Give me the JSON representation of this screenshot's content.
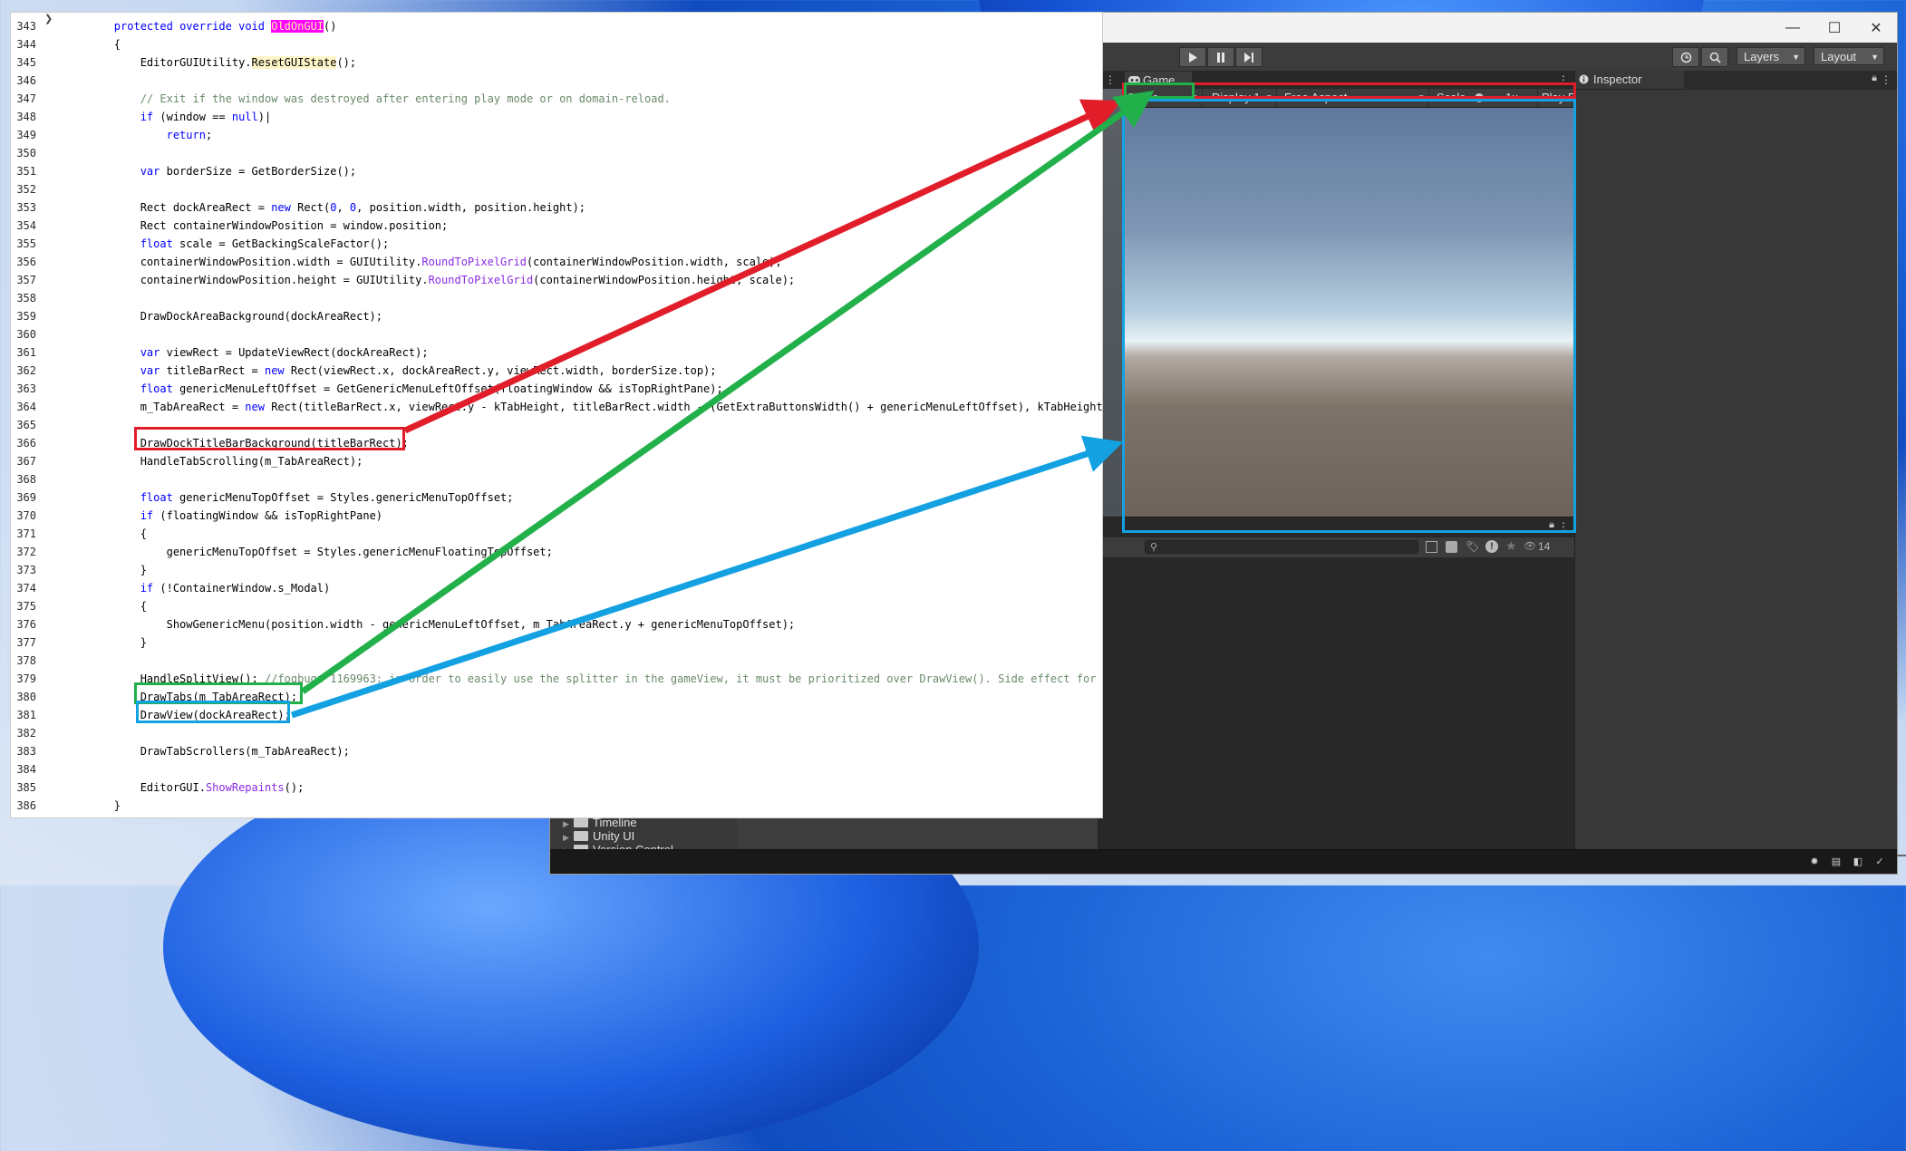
{
  "unity": {
    "window_controls": {
      "minimize": "—",
      "maximize": "☐",
      "close": "✕"
    },
    "toolbar": {
      "layers": "Layers",
      "layout": "Layout"
    },
    "game_tab": {
      "label": "Game"
    },
    "game_controls": {
      "mode": "Game",
      "display": "Display 1",
      "aspect": "Free Aspect",
      "scale_label": "Scale",
      "scale_value": "1x",
      "play_label": "Play F"
    },
    "inspector": {
      "label": "Inspector"
    },
    "bottom_panel": {
      "hidden_count": "14"
    },
    "project_tree": [
      "Timeline",
      "Unity UI",
      "Version Control"
    ]
  },
  "code": [
    {
      "n": "343",
      "html": "        <span class=\"kw\">protected</span> <span class=\"kw\">override</span> <span class=\"kw\">void</span> <span class=\"hl\">OldOnGUI</span>()"
    },
    {
      "n": "344",
      "html": "        {"
    },
    {
      "n": "345",
      "html": "            EditorGUIUtility.<span class=\"hlc\">ResetGUIState</span>();"
    },
    {
      "n": "346",
      "html": ""
    },
    {
      "n": "347",
      "html": "            <span class=\"cm\">// Exit if the window was destroyed after entering play mode or on domain-reload.</span>"
    },
    {
      "n": "348",
      "html": "            <span class=\"kw\">if</span> (window == <span class=\"kw\">null</span>)|"
    },
    {
      "n": "349",
      "html": "                <span class=\"kw\">return</span>;"
    },
    {
      "n": "350",
      "html": ""
    },
    {
      "n": "351",
      "html": "            <span class=\"kw\">var</span> borderSize = GetBorderSize();"
    },
    {
      "n": "352",
      "html": ""
    },
    {
      "n": "353",
      "html": "            Rect dockAreaRect = <span class=\"kw\">new</span> Rect(<span class=\"kw\">0</span>, <span class=\"kw\">0</span>, position.width, position.height);"
    },
    {
      "n": "354",
      "html": "            Rect containerWindowPosition = window.position;"
    },
    {
      "n": "355",
      "html": "            <span class=\"kw\">float</span> scale = GetBackingScaleFactor();"
    },
    {
      "n": "356",
      "html": "            containerWindowPosition.width = GUIUtility.<span class=\"md\">RoundToPixelGrid</span>(containerWindowPosition.width, scale);"
    },
    {
      "n": "357",
      "html": "            containerWindowPosition.height = GUIUtility.<span class=\"md\">RoundToPixelGrid</span>(containerWindowPosition.height, scale);"
    },
    {
      "n": "358",
      "html": ""
    },
    {
      "n": "359",
      "html": "            DrawDockAreaBackground(dockAreaRect);"
    },
    {
      "n": "360",
      "html": ""
    },
    {
      "n": "361",
      "html": "            <span class=\"kw\">var</span> viewRect = UpdateViewRect(dockAreaRect);"
    },
    {
      "n": "362",
      "html": "            <span class=\"kw\">var</span> titleBarRect = <span class=\"kw\">new</span> Rect(viewRect.x, dockAreaRect.y, viewRect.width, borderSize.top);"
    },
    {
      "n": "363",
      "html": "            <span class=\"kw\">float</span> genericMenuLeftOffset = GetGenericMenuLeftOffset(floatingWindow &amp;&amp; isTopRightPane);"
    },
    {
      "n": "364",
      "html": "            m_TabAreaRect = <span class=\"kw\">new</span> Rect(titleBarRect.x, viewRect.y - kTabHeight, titleBarRect.width - (GetExtraButtonsWidth() + genericMenuLeftOffset), kTabHeight);"
    },
    {
      "n": "365",
      "html": ""
    },
    {
      "n": "366",
      "html": "            DrawDockTitleBarBackground(titleBarRect);"
    },
    {
      "n": "367",
      "html": "            HandleTabScrolling(m_TabAreaRect);"
    },
    {
      "n": "368",
      "html": ""
    },
    {
      "n": "369",
      "html": "            <span class=\"kw\">float</span> genericMenuTopOffset = Styles.genericMenuTopOffset;"
    },
    {
      "n": "370",
      "html": "            <span class=\"kw\">if</span> (floatingWindow &amp;&amp; isTopRightPane)"
    },
    {
      "n": "371",
      "html": "            {"
    },
    {
      "n": "372",
      "html": "                genericMenuTopOffset = Styles.genericMenuFloatingTopOffset;"
    },
    {
      "n": "373",
      "html": "            }"
    },
    {
      "n": "374",
      "html": "            <span class=\"kw\">if</span> (!ContainerWindow.s_Modal)"
    },
    {
      "n": "375",
      "html": "            {"
    },
    {
      "n": "376",
      "html": "                ShowGenericMenu(position.width - genericMenuLeftOffset, m_TabAreaRect.y + genericMenuTopOffset);"
    },
    {
      "n": "377",
      "html": "            }"
    },
    {
      "n": "378",
      "html": ""
    },
    {
      "n": "379",
      "html": "            HandleSplitView(); <span class=\"cm\">//fogbugz 1169963: in order to easily use the splitter in the gameView, it must be prioritized over DrawView(). Side effect for touch</span>"
    },
    {
      "n": "380",
      "html": "            DrawTabs(m_TabAreaRect);"
    },
    {
      "n": "381",
      "html": "            DrawView(dockAreaRect);"
    },
    {
      "n": "382",
      "html": ""
    },
    {
      "n": "383",
      "html": "            DrawTabScrollers(m_TabAreaRect);"
    },
    {
      "n": "384",
      "html": ""
    },
    {
      "n": "385",
      "html": "            EditorGUI.<span class=\"md\">ShowRepaints</span>();"
    },
    {
      "n": "386",
      "html": "        }"
    }
  ],
  "annotation_colors": {
    "red": "#e11d2a",
    "green": "#22b04b",
    "blue": "#13a1e2"
  }
}
